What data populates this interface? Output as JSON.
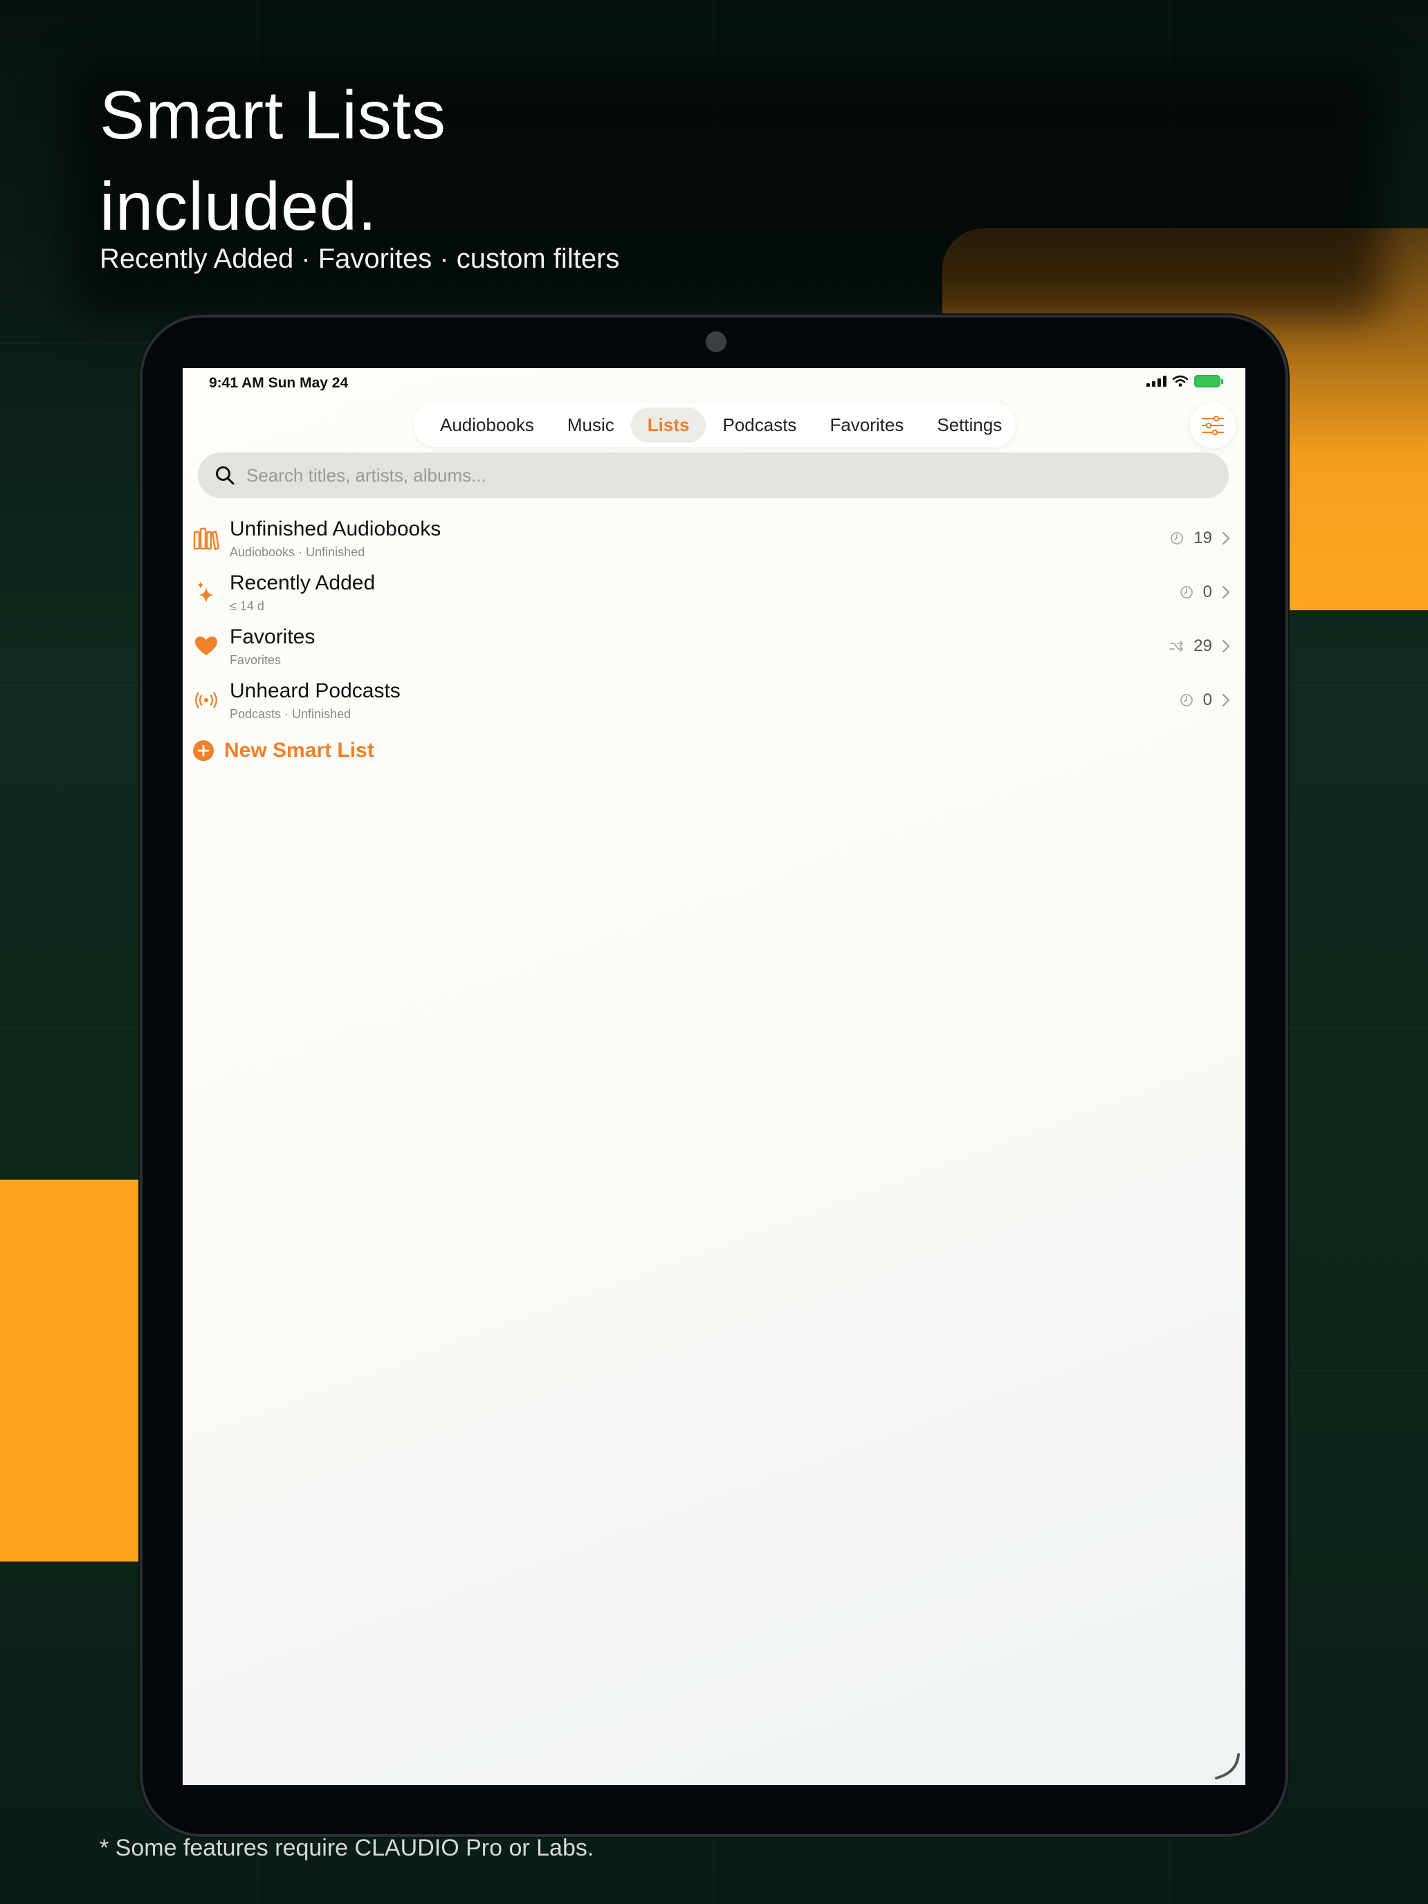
{
  "marketing": {
    "headline_line1": "Smart Lists",
    "headline_line2": "included.",
    "subheadline": "Recently Added · Favorites · custom filters",
    "footnote": "* Some features require CLAUDIO Pro or Labs."
  },
  "status_bar": {
    "time": "9:41 AM   Sun May 24"
  },
  "tabs": [
    {
      "label": "Audiobooks",
      "active": false
    },
    {
      "label": "Music",
      "active": false
    },
    {
      "label": "Lists",
      "active": true
    },
    {
      "label": "Podcasts",
      "active": false
    },
    {
      "label": "Favorites",
      "active": false
    },
    {
      "label": "Settings",
      "active": false
    }
  ],
  "search": {
    "placeholder": "Search titles, artists, albums..."
  },
  "smart_lists": [
    {
      "icon": "books-icon",
      "title": "Unfinished Audiobooks",
      "subtitle": "Audiobooks · Unfinished",
      "count": "19",
      "meta_icon": "clock-icon"
    },
    {
      "icon": "sparkle-icon",
      "title": "Recently Added",
      "subtitle": "≤ 14 d",
      "count": "0",
      "meta_icon": "clock-icon"
    },
    {
      "icon": "heart-icon",
      "title": "Favorites",
      "subtitle": "Favorites",
      "count": "29",
      "meta_icon": "shuffle-icon"
    },
    {
      "icon": "broadcast-icon",
      "title": "Unheard Podcasts",
      "subtitle": "Podcasts · Unfinished",
      "count": "0",
      "meta_icon": "clock-icon"
    }
  ],
  "new_list_label": "New Smart List",
  "colors": {
    "accent": "#f0802a",
    "orange_panel": "#ffa21e",
    "background": "#0b1a14"
  }
}
